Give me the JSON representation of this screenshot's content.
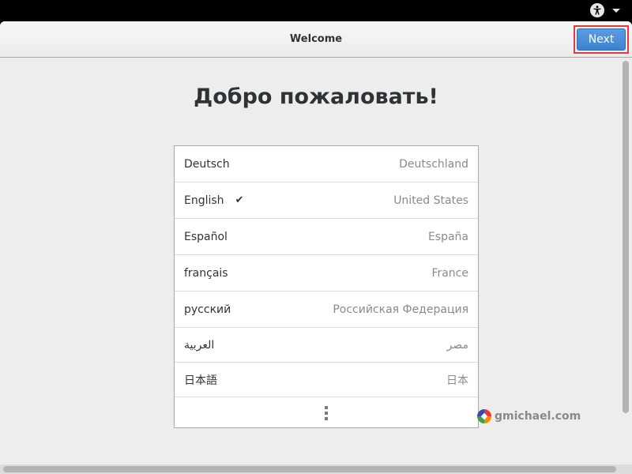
{
  "topbar": {
    "accessibility_icon": "accessibility-icon",
    "menu_icon": "caret-down-icon"
  },
  "header": {
    "title": "Welcome",
    "next_label": "Next"
  },
  "main": {
    "heading": "Добро пожаловать!",
    "languages": [
      {
        "language": "Deutsch",
        "country": "Deutschland",
        "selected": false
      },
      {
        "language": "English",
        "country": "United States",
        "selected": true
      },
      {
        "language": "Español",
        "country": "España",
        "selected": false
      },
      {
        "language": "français",
        "country": "France",
        "selected": false
      },
      {
        "language": "русский",
        "country": "Российская Федерация",
        "selected": false
      },
      {
        "language": "العربية",
        "country": "مصر",
        "selected": false
      },
      {
        "language": "日本語",
        "country": "日本",
        "selected": false
      }
    ],
    "check_glyph": "✔",
    "more_icon": "more-vertical-icon"
  },
  "watermark": {
    "text": "gmichael.com"
  },
  "colors": {
    "accent": "#3d82d0",
    "highlight_border": "#e23b3b"
  }
}
